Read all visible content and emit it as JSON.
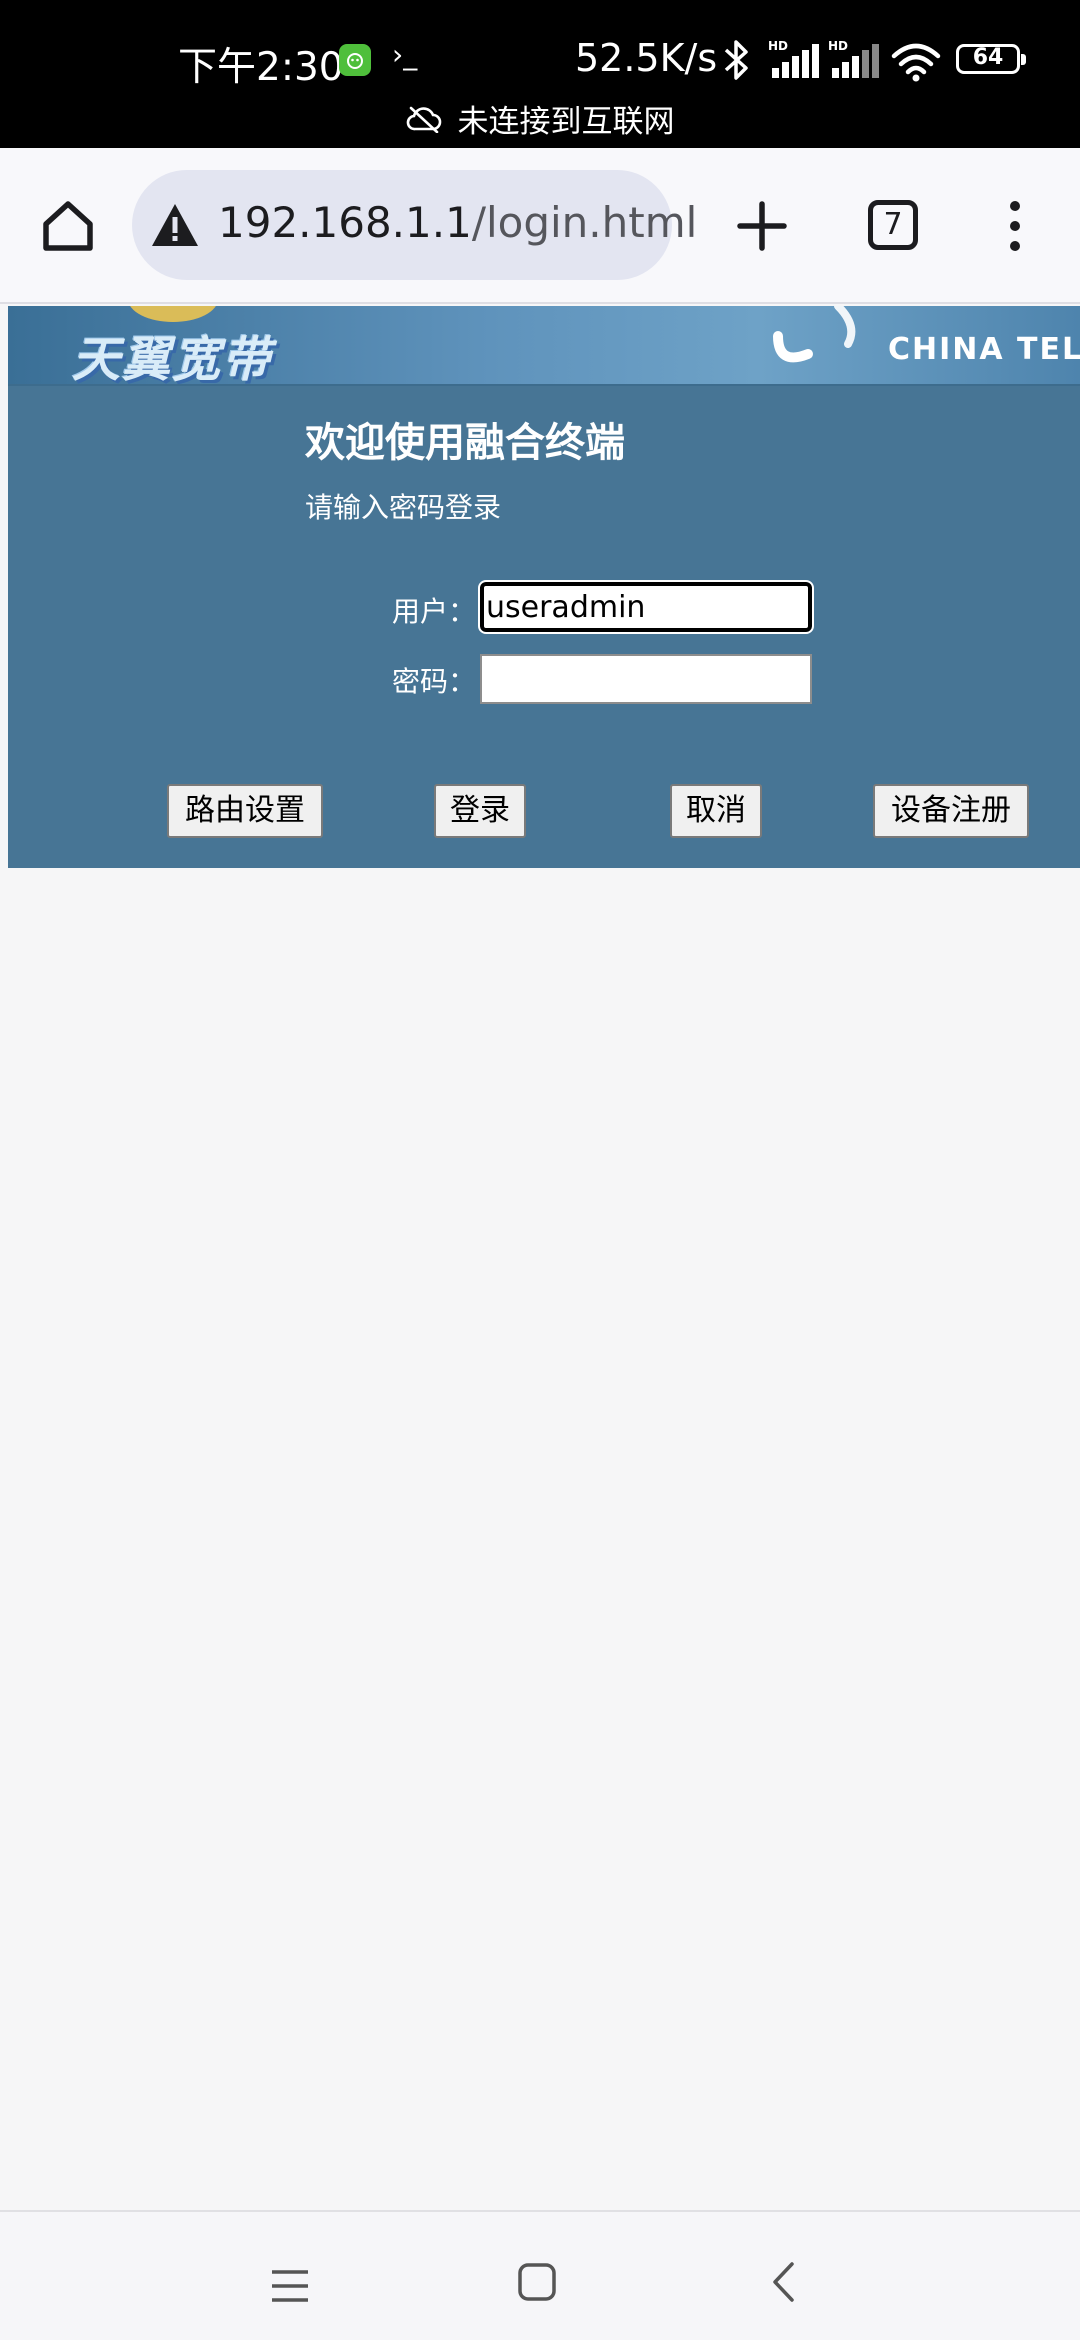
{
  "status_bar": {
    "time": "下午2:30",
    "terminal_glyph": "›_",
    "net_speed": "52.5K/s",
    "battery_level": "64",
    "network_notice": "未连接到互联网"
  },
  "browser": {
    "url_host": "192.168.1.1",
    "url_path": "/login.html",
    "tab_count": "7"
  },
  "page": {
    "banner": {
      "logo_text": "天翼宽带",
      "brand_text": "CHINA TELE"
    },
    "welcome_title": "欢迎使用融合终端",
    "subtitle": "请输入密码登录",
    "username_label": "用户：",
    "username_value": "useradmin",
    "password_label": "密码：",
    "password_value": "",
    "buttons": {
      "router_settings": "路由设置",
      "login": "登录",
      "cancel": "取消",
      "device_register": "设备注册"
    }
  },
  "colors": {
    "page_bg": "#477595",
    "browser_bg": "#f8f8fb",
    "url_pill": "#e3e5f1"
  }
}
